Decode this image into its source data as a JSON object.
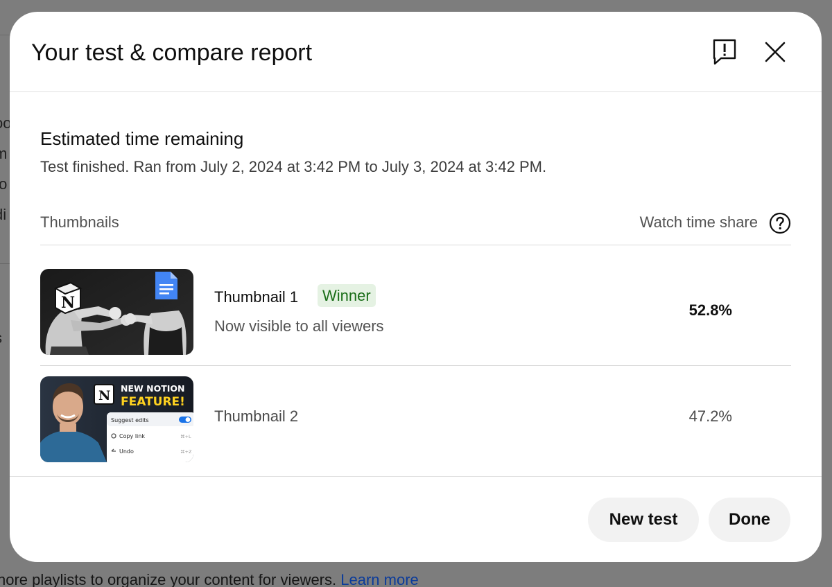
{
  "background": {
    "fragments": [
      "oo",
      "m",
      "to",
      "di",
      "s"
    ],
    "footer_text": "nore playlists to organize your content for viewers.",
    "footer_link": "Learn more"
  },
  "dialog": {
    "title": "Your test & compare report",
    "section_title": "Estimated time remaining",
    "section_subtitle": "Test finished. Ran from July 2, 2024 at 3:42 PM to July 3, 2024 at 3:42 PM.",
    "table": {
      "col_thumbnails": "Thumbnails",
      "col_watch_time": "Watch time share",
      "rows": [
        {
          "name": "Thumbnail 1",
          "badge": "Winner",
          "subtitle": "Now visible to all viewers",
          "share": "52.8%"
        },
        {
          "name": "Thumbnail 2",
          "share": "47.2%"
        }
      ]
    },
    "thumb2": {
      "headline_1": "NEW NOTION",
      "headline_2": "FEATURE!",
      "menu": [
        "Suggest edits",
        "Copy link",
        "Undo"
      ],
      "shortcuts": [
        "⌘+L",
        "⌘+Z"
      ]
    },
    "buttons": {
      "new_test": "New test",
      "done": "Done"
    }
  },
  "colors": {
    "winner_bg": "#e5f2e3",
    "winner_text": "#1a6e18",
    "doc_blue": "#4285f4",
    "thumb2_yellow": "#ffd21f",
    "toggle_blue": "#1a73e8"
  }
}
